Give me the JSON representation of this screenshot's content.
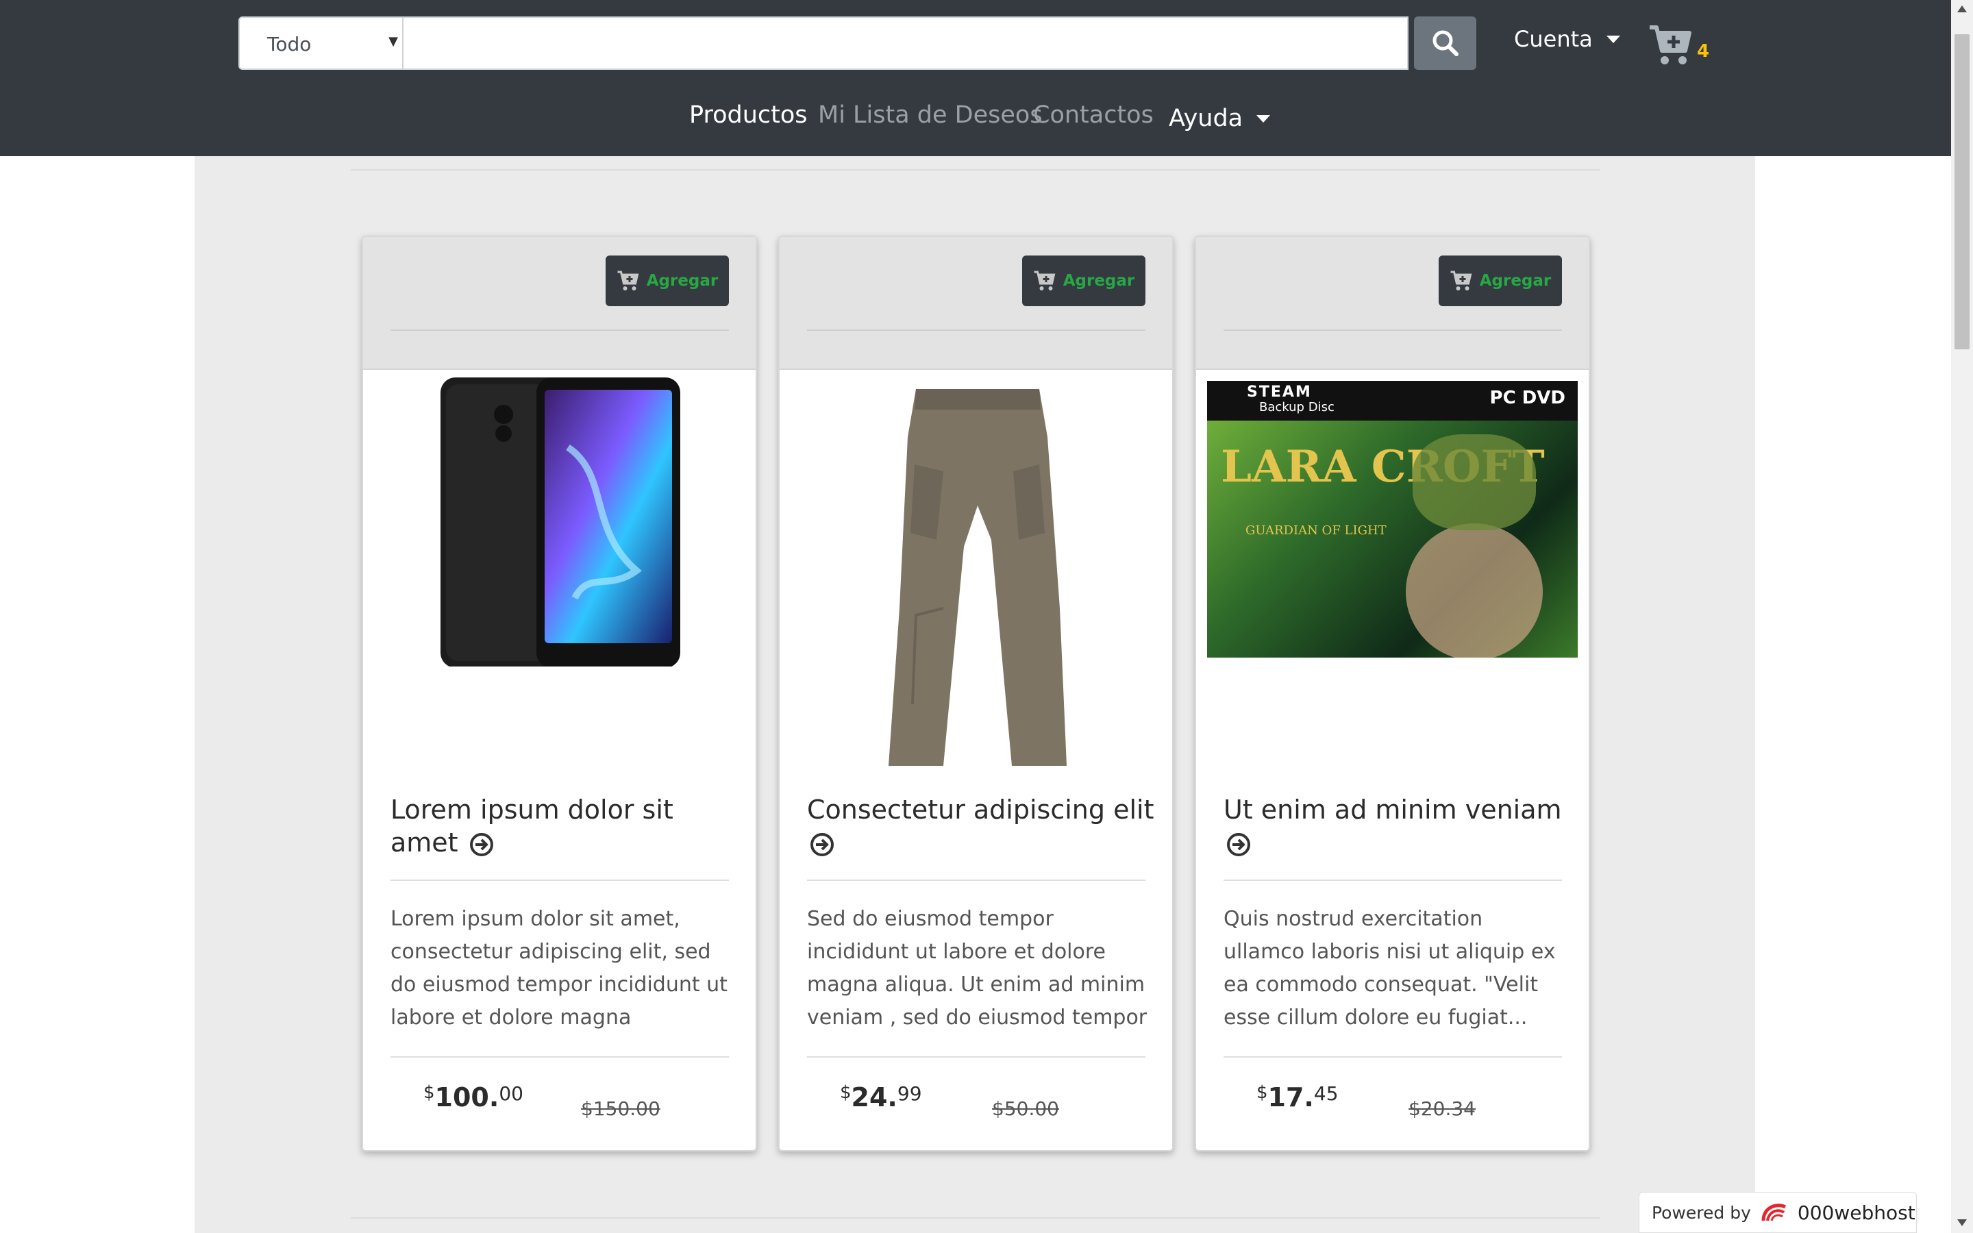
{
  "header": {
    "category_select": {
      "value": "Todo"
    },
    "search": {
      "value": "",
      "placeholder": ""
    },
    "account_label": "Cuenta",
    "cart_count": "4"
  },
  "nav": {
    "items": [
      {
        "label": "Productos",
        "active": true
      },
      {
        "label": "Mi Lista de Deseos",
        "active": false
      },
      {
        "label": "Contactos",
        "active": false
      },
      {
        "label": "Ayuda",
        "active": false,
        "dropdown": true
      }
    ]
  },
  "products": [
    {
      "add_label": "Agregar",
      "image": "smartphone (Siragon)",
      "title": "Lorem ipsum dolor sit amet",
      "description": "Lorem ipsum dolor sit amet, consectetur adipiscing elit, sed do eiusmod tempor incididunt ut labore et dolore magna",
      "price_symbol": "$",
      "price_int": "100.",
      "price_cents": "00",
      "old_price": "$150.00"
    },
    {
      "add_label": "Agregar",
      "image": "cargo pants",
      "title": "Consectetur adipiscing elit",
      "description": "Sed do eiusmod tempor incididunt ut labore et dolore magna aliqua. Ut enim ad minim veniam , sed do eiusmod tempor",
      "price_symbol": "$",
      "price_int": "24.",
      "price_cents": "99",
      "old_price": "$50.00"
    },
    {
      "add_label": "Agregar",
      "image": "game cover",
      "image_texts": {
        "steam": "STEAM",
        "backup": "Backup Disc",
        "pcdvd": "PC DVD",
        "game_title": "LARA CROFT",
        "game_subtitle": "GUARDIAN OF LIGHT"
      },
      "title": "Ut enim ad minim veniam",
      "description": "Quis nostrud exercitation ullamco laboris nisi ut aliquip ex ea commodo consequat. \"Velit esse cillum dolore eu fugiat...",
      "price_symbol": "$",
      "price_int": "17.",
      "price_cents": "45",
      "old_price": "$20.34"
    }
  ],
  "footer": {
    "powered_prefix": "Powered by",
    "powered_brand": "000webhost"
  },
  "colors": {
    "header_bg": "#343a40",
    "accent_green": "#28a745",
    "cart_badge": "#ffc107",
    "main_bg": "#ebebeb"
  },
  "icons": [
    "search-icon",
    "cart-plus-icon",
    "arrow-circle-right-icon",
    "caret-down-icon",
    "000webhost-logo-icon"
  ]
}
